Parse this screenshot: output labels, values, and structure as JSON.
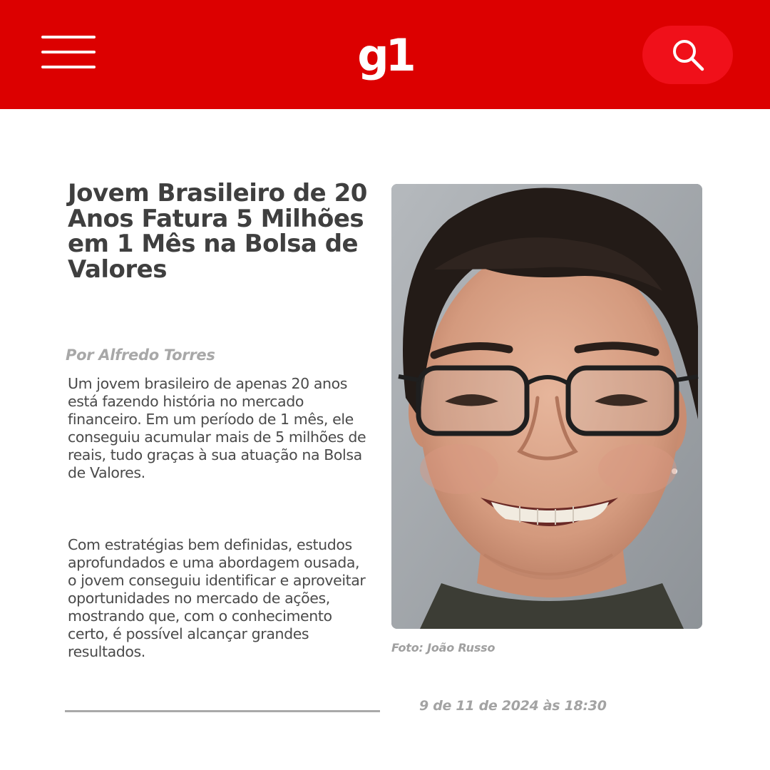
{
  "header": {
    "logo": "g1",
    "menu_icon": "hamburger-menu-icon",
    "search_icon": "search-icon",
    "background_color": "#dc0000",
    "search_button_color": "#f0101a"
  },
  "article": {
    "title": "Jovem Brasileiro de 20 Anos Fatura 5 Milhões em 1 Mês na Bolsa de Valores",
    "author": "Por Alfredo Torres",
    "paragraphs": [
      "Um jovem brasileiro de apenas 20 anos está fazendo história no mercado financeiro. Em um período de 1 mês, ele conseguiu acumular mais de 5 milhões de reais, tudo graças à sua atuação na Bolsa de Valores.",
      "Com estratégias bem definidas, estudos aprofundados e uma abordagem ousada, o jovem conseguiu identificar e aproveitar oportunidades no mercado de ações, mostrando que, com o conhecimento certo, é possível alcançar grandes resultados."
    ],
    "photo_caption": "Foto: João Russo",
    "timestamp": "9 de 11 de 2024 às 18:30"
  }
}
